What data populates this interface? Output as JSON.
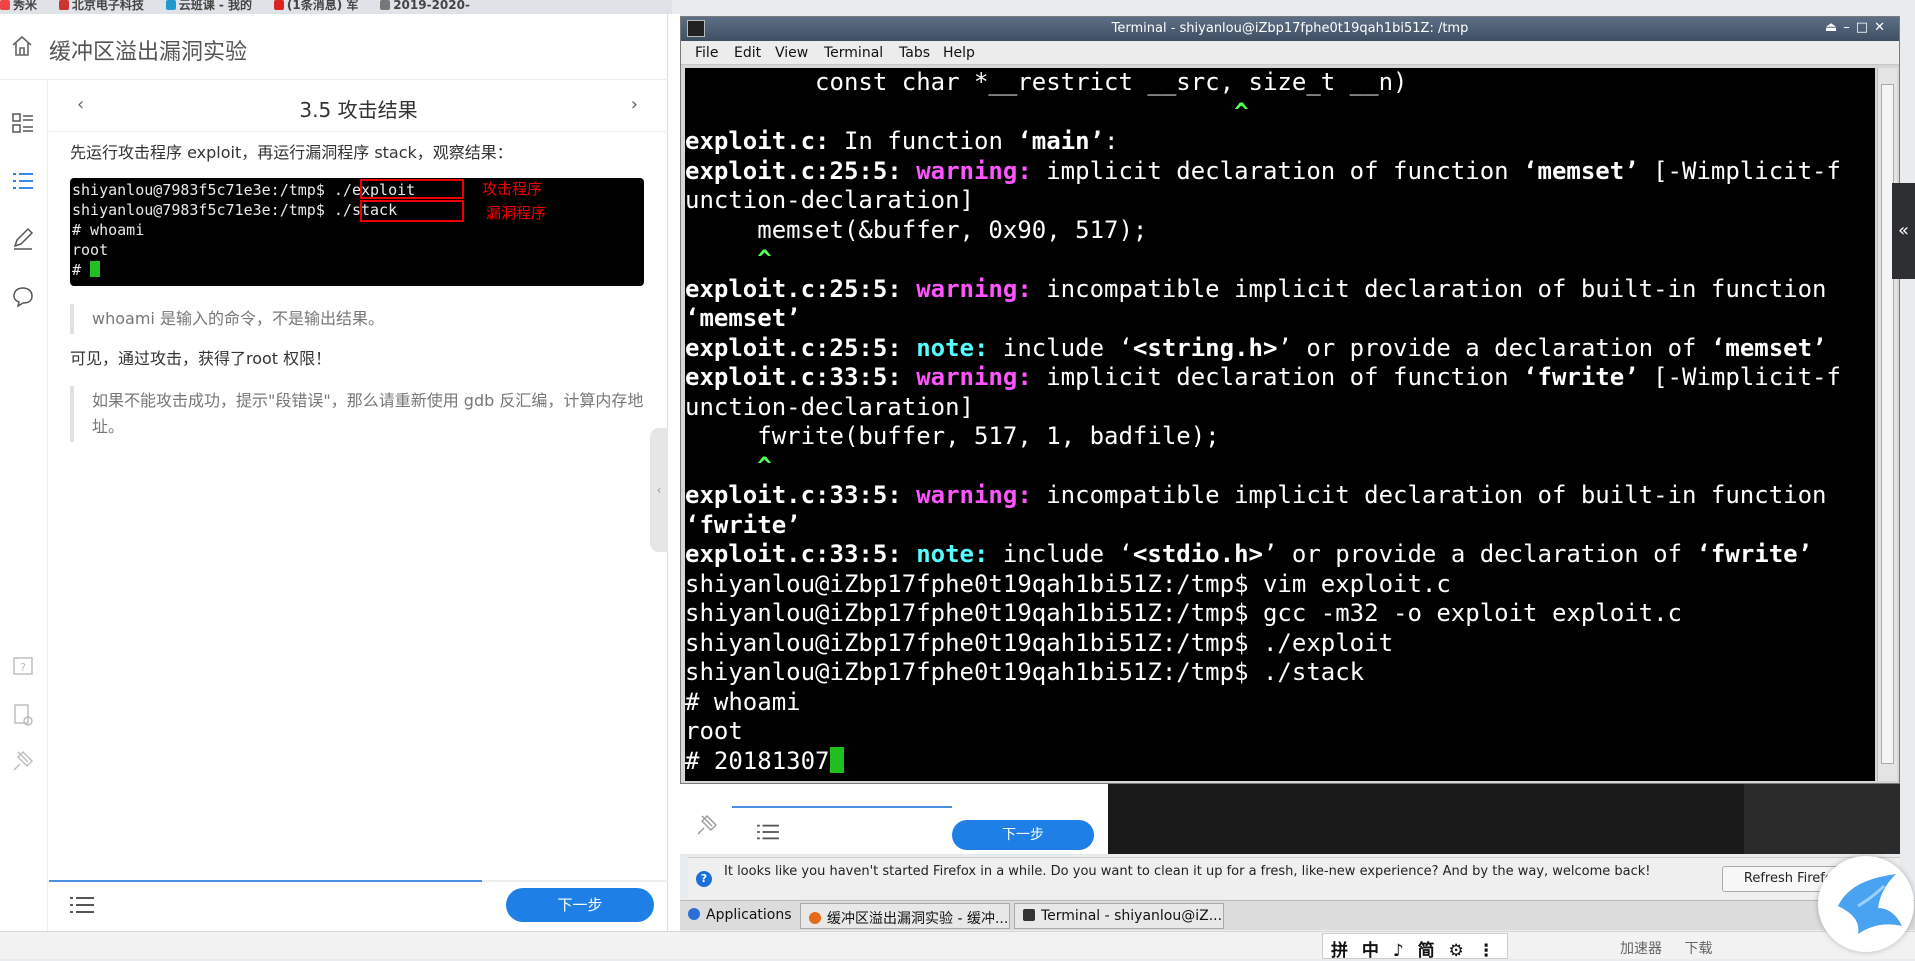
{
  "bookmarks": [
    "秀米",
    "北京电子科技",
    "云班课 - 我的",
    "(1条消息) 军",
    "2019-2020-"
  ],
  "lab": {
    "title": "缓冲区溢出漏洞实验",
    "step_title": "3.5 攻击结果",
    "intro": "先运行攻击程序 exploit，再运行漏洞程序 stack，观察结果：",
    "screenshot": {
      "lines": [
        "shiyanlou@7983f5c71e3e:/tmp$ ./exploit",
        "shiyanlou@7983f5c71e3e:/tmp$ ./stack",
        "# whoami",
        "root",
        "# "
      ],
      "label_exploit": "攻击程序",
      "label_stack": "漏洞程序"
    },
    "note1": "whoami 是输入的命令，不是输出结果。",
    "result": "可见，通过攻击，获得了root 权限！",
    "note2": "如果不能攻击成功，提示\"段错误\"，那么请重新使用 gdb 反汇编，计算内存地址。",
    "next_label": "下一步"
  },
  "terminal": {
    "title": "Terminal - shiyanlou@iZbp17fphe0t19qah1bi51Z: /tmp",
    "menu": [
      "File",
      "Edit",
      "View",
      "Terminal",
      "Tabs",
      "Help"
    ],
    "lines": {
      "l1": "         const char *__restrict __src, size_t __n)",
      "l2": "                                      ^",
      "l3a": "exploit.c:",
      "l3b": " In function ",
      "l3c": "‘main’",
      "l3d": ":",
      "l4a": "exploit.c:25:5: ",
      "l4w": "warning:",
      "l4b": " implicit declaration of function ",
      "l4c": "‘memset’",
      "l4d": " [-Wimplicit-f",
      "l5": "unction-declaration]",
      "l6": "     memset(&buffer, 0x90, 517);",
      "l7": "     ^",
      "l8a": "exploit.c:25:5: ",
      "l8w": "warning:",
      "l8b": " incompatible implicit declaration of built-in function",
      "l9": "‘memset’",
      "l10a": "exploit.c:25:5: ",
      "l10n": "note:",
      "l10b": " include ‘",
      "l10c": "<string.h>",
      "l10d": "’ or provide a declaration of ",
      "l10e": "‘memset’",
      "l11a": "exploit.c:33:5: ",
      "l11w": "warning:",
      "l11b": " implicit declaration of function ",
      "l11c": "‘fwrite’",
      "l11d": " [-Wimplicit-f",
      "l12": "unction-declaration]",
      "l13": "     fwrite(buffer, 517, 1, badfile);",
      "l14": "     ^",
      "l15a": "exploit.c:33:5: ",
      "l15w": "warning:",
      "l15b": " incompatible implicit declaration of built-in function",
      "l16": "‘fwrite’",
      "l17a": "exploit.c:33:5: ",
      "l17n": "note:",
      "l17b": " include ‘",
      "l17c": "<stdio.h>",
      "l17d": "’ or provide a declaration of ",
      "l17e": "‘fwrite’",
      "l18": "shiyanlou@iZbp17fphe0t19qah1bi51Z:/tmp$ vim exploit.c",
      "l19": "shiyanlou@iZbp17fphe0t19qah1bi51Z:/tmp$ gcc -m32 -o exploit exploit.c",
      "l20": "shiyanlou@iZbp17fphe0t19qah1bi51Z:/tmp$ ./exploit",
      "l21": "shiyanlou@iZbp17fphe0t19qah1bi51Z:/tmp$ ./stack",
      "l22": "# whoami",
      "l23": "root",
      "l24": "# 20181307"
    }
  },
  "under": {
    "next_label": "下一步"
  },
  "firefox_notice": {
    "text": "It looks like you haven't started Firefox in a while. Do you want to clean it up for a fresh, like-new experience? And by the way, welcome back!",
    "refresh_label": "Refresh Firefox"
  },
  "taskbar": {
    "apps_label": "Applications",
    "task1": "缓冲区溢出漏洞实验 - 缓冲...",
    "task2": "Terminal - shiyanlou@iZ..."
  },
  "tray": {
    "ime": "拼 中 ♪ 简 ⚙ ⋮",
    "items": [
      "加速器",
      "下载"
    ]
  },
  "colors": {
    "accent": "#1e7fe6",
    "warning": "#ff55ff",
    "note": "#55ffff",
    "caret": "#55ff55"
  }
}
